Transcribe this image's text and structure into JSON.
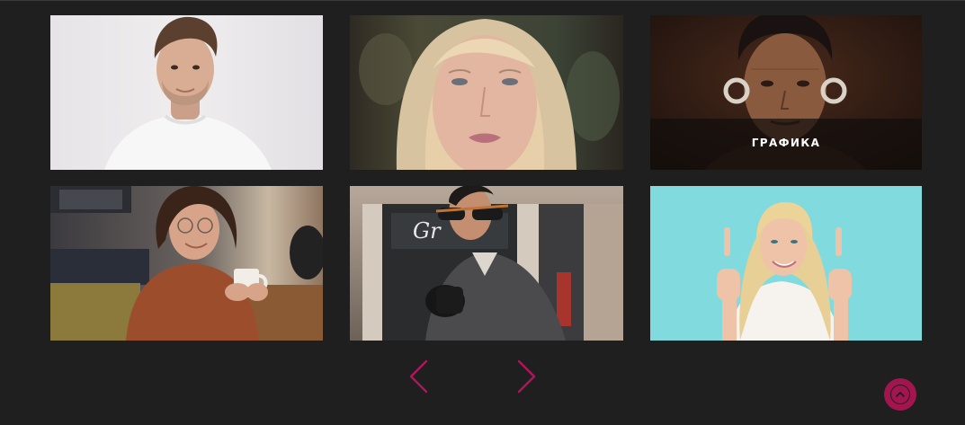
{
  "gallery": {
    "items": [
      {
        "alt": "man-white-tshirt-photo",
        "overlay_label": ""
      },
      {
        "alt": "blonde-woman-closeup-photo",
        "overlay_label": ""
      },
      {
        "alt": "elderly-woman-earrings-photo",
        "overlay_label": "ГРАФИКА"
      },
      {
        "alt": "woman-glasses-coffee-photo",
        "overlay_label": ""
      },
      {
        "alt": "man-sunglasses-street-photo",
        "overlay_label": ""
      },
      {
        "alt": "woman-pointing-up-photo",
        "overlay_label": ""
      }
    ]
  },
  "pagination": {
    "prev_icon": "chevron-left-icon",
    "next_icon": "chevron-right-icon"
  },
  "scroll_top": {
    "icon": "chevron-up-icon"
  },
  "colors": {
    "background": "#1f1f1f",
    "accent": "#a3154f",
    "overlay": "#120e0c"
  }
}
